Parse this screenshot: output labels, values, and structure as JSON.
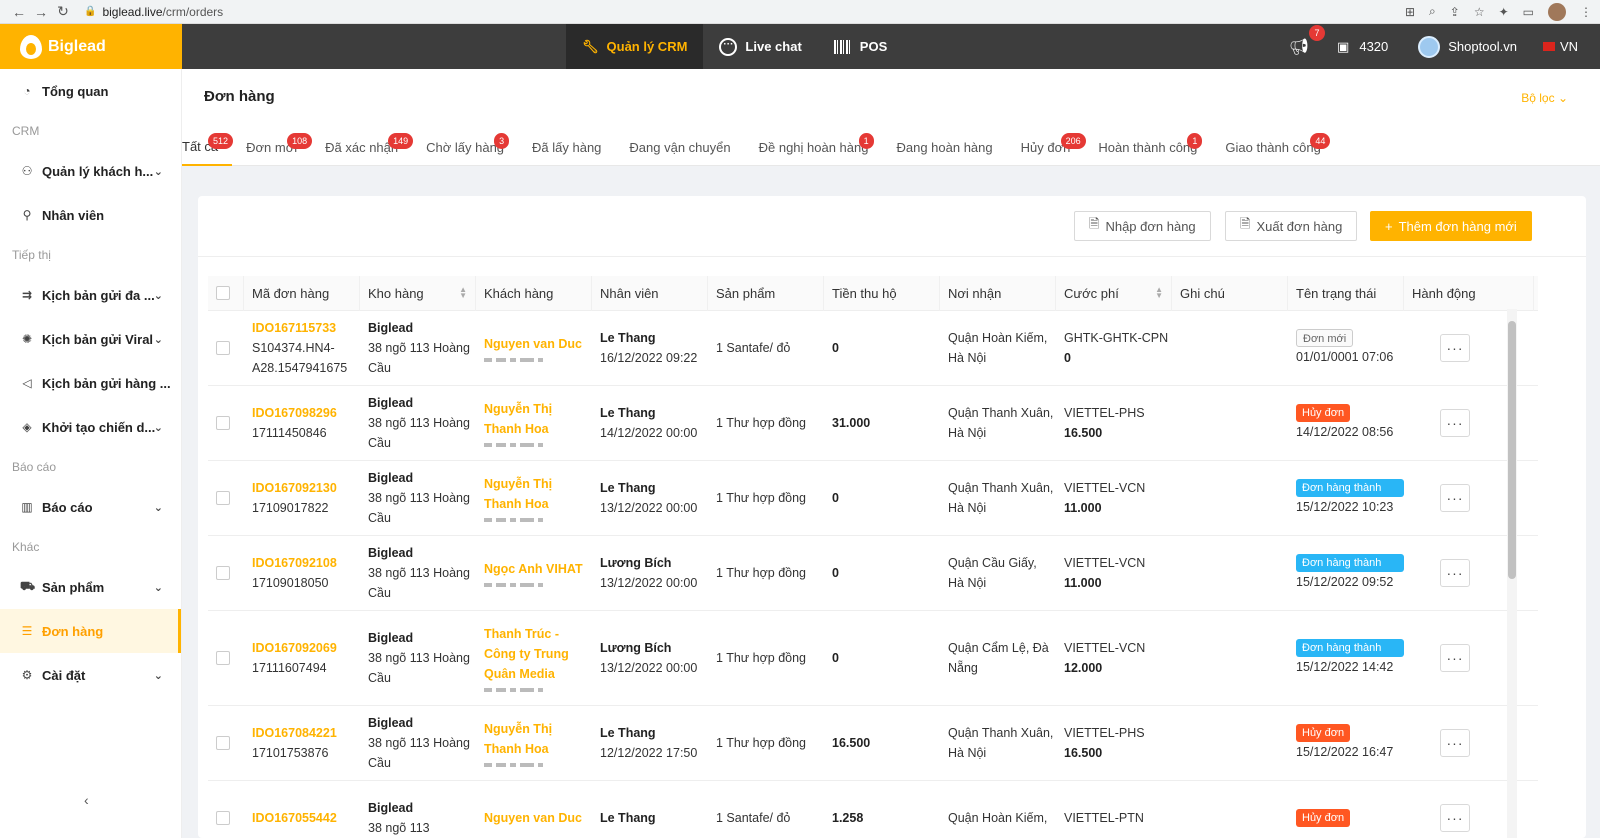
{
  "browser": {
    "url_domain": "biglead.live",
    "url_path": "/crm/orders"
  },
  "header": {
    "logo": "Biglead",
    "nav": [
      {
        "label": "Quản lý CRM"
      },
      {
        "label": "Live chat"
      },
      {
        "label": "POS"
      }
    ],
    "notification_count": "7",
    "credits": "4320",
    "shop_name": "Shoptool.vn",
    "language": "VN"
  },
  "sidebar": {
    "overview": "Tổng quan",
    "group_crm": "CRM",
    "customers": "Quản lý khách h...",
    "staff": "Nhân viên",
    "group_marketing": "Tiếp thị",
    "script_multi": "Kịch bản gửi đa ...",
    "script_viral": "Kịch bản gửi Viral",
    "script_batch": "Kịch bản gửi hàng ...",
    "campaign": "Khởi tạo chiến d...",
    "group_report": "Báo cáo",
    "report": "Báo cáo",
    "group_other": "Khác",
    "products": "Sản phẩm",
    "orders": "Đơn hàng",
    "settings": "Cài đặt"
  },
  "page": {
    "title": "Đơn hàng",
    "filter": "Bộ lọc"
  },
  "tabs": [
    {
      "label": "Tất cả",
      "count": "512"
    },
    {
      "label": "Đơn mới",
      "count": "108"
    },
    {
      "label": "Đã xác nhận",
      "count": "149"
    },
    {
      "label": "Chờ lấy hàng",
      "count": "3"
    },
    {
      "label": "Đã lấy hàng",
      "count": ""
    },
    {
      "label": "Đang vận chuyển",
      "count": ""
    },
    {
      "label": "Đề nghị hoàn hàng",
      "count": "1"
    },
    {
      "label": "Đang hoàn hàng",
      "count": ""
    },
    {
      "label": "Hủy đơn",
      "count": "206"
    },
    {
      "label": "Hoàn thành công",
      "count": "1"
    },
    {
      "label": "Giao thành công",
      "count": "44"
    }
  ],
  "actions": {
    "import": "Nhập đơn hàng",
    "export": "Xuất đơn hàng",
    "add": "Thêm đơn hàng mới"
  },
  "table": {
    "columns": [
      "Mã đơn hàng",
      "Kho hàng",
      "Khách hàng",
      "Nhân viên",
      "Sản phẩm",
      "Tiền thu hộ",
      "Nơi nhận",
      "Cước phí",
      "Ghi chú",
      "Tên trạng thái",
      "Hành động"
    ],
    "rows": [
      {
        "code": "IDO167115733",
        "sub": "S104374.HN4-A28.1547941675",
        "store": "Biglead",
        "store_addr": "38 ngõ 113 Hoàng Cầu",
        "customer": "Nguyen van Duc",
        "staff": "Le Thang",
        "date": "16/12/2022 09:22",
        "product": "1 Santafe/ đỏ",
        "cod": "0",
        "address": "Quận Hoàn Kiếm, Hà Nội",
        "carrier": "GHTK-GHTK-CPN",
        "fee": "0",
        "note": "",
        "status": "Đơn mới",
        "status_type": "new",
        "status_time": "01/01/0001 07:06"
      },
      {
        "code": "IDO167098296",
        "sub": "17111450846",
        "store": "Biglead",
        "store_addr": "38 ngõ 113 Hoàng Cầu",
        "customer": "Nguyễn Thị Thanh Hoa",
        "staff": "Le Thang",
        "date": "14/12/2022 00:00",
        "product": "1 Thư hợp đồng",
        "cod": "31.000",
        "address": "Quận Thanh Xuân, Hà Nội",
        "carrier": "VIETTEL-PHS",
        "fee": "16.500",
        "note": "",
        "status": "Hủy đơn",
        "status_type": "cancel",
        "status_time": "14/12/2022 08:56"
      },
      {
        "code": "IDO167092130",
        "sub": "17109017822",
        "store": "Biglead",
        "store_addr": "38 ngõ 113 Hoàng Cầu",
        "customer": "Nguyễn Thị Thanh Hoa",
        "staff": "Le Thang",
        "date": "13/12/2022 00:00",
        "product": "1 Thư hợp đồng",
        "cod": "0",
        "address": "Quận Thanh Xuân, Hà Nội",
        "carrier": "VIETTEL-VCN",
        "fee": "11.000",
        "note": "",
        "status": "Đơn hàng thành công",
        "status_type": "success",
        "status_time": "15/12/2022 10:23"
      },
      {
        "code": "IDO167092108",
        "sub": "17109018050",
        "store": "Biglead",
        "store_addr": "38 ngõ 113 Hoàng Cầu",
        "customer": "Ngọc Anh VIHAT",
        "staff": "Lương Bích",
        "date": "13/12/2022 00:00",
        "product": "1 Thư hợp đồng",
        "cod": "0",
        "address": "Quận Cầu Giấy, Hà Nội",
        "carrier": "VIETTEL-VCN",
        "fee": "11.000",
        "note": "",
        "status": "Đơn hàng thành công",
        "status_type": "success",
        "status_time": "15/12/2022 09:52"
      },
      {
        "code": "IDO167092069",
        "sub": "17111607494",
        "store": "Biglead",
        "store_addr": "38 ngõ 113 Hoàng Cầu",
        "customer": "Thanh Trúc - Công ty Trung Quân Media",
        "staff": "Lương Bích",
        "date": "13/12/2022 00:00",
        "product": "1 Thư hợp đồng",
        "cod": "0",
        "address": "Quận Cẩm Lệ, Đà Nẵng",
        "carrier": "VIETTEL-VCN",
        "fee": "12.000",
        "note": "",
        "status": "Đơn hàng thành công",
        "status_type": "success",
        "status_time": "15/12/2022 14:42"
      },
      {
        "code": "IDO167084221",
        "sub": "17101753876",
        "store": "Biglead",
        "store_addr": "38 ngõ 113 Hoàng Cầu",
        "customer": "Nguyễn Thị Thanh Hoa",
        "staff": "Le Thang",
        "date": "12/12/2022 17:50",
        "product": "1 Thư hợp đồng",
        "cod": "16.500",
        "address": "Quận Thanh Xuân, Hà Nội",
        "carrier": "VIETTEL-PHS",
        "fee": "16.500",
        "note": "",
        "status": "Hủy đơn",
        "status_type": "cancel",
        "status_time": "15/12/2022 16:47"
      },
      {
        "code": "IDO167055442",
        "sub": "",
        "store": "Biglead",
        "store_addr": "38 ngõ 113",
        "customer": "Nguyen van Duc",
        "staff": "Le Thang",
        "date": "",
        "product": "1 Santafe/ đỏ",
        "cod": "1.258",
        "address": "Quận Hoàn Kiếm,",
        "carrier": "VIETTEL-PTN",
        "fee": "",
        "note": "",
        "status": "Hủy đơn",
        "status_type": "cancel",
        "status_time": ""
      }
    ]
  },
  "colors": {
    "brand": "#ffb300",
    "header_bg": "#3d3d3d",
    "cancel": "#ff5722",
    "success": "#29b6f6",
    "badge": "#e53935"
  }
}
